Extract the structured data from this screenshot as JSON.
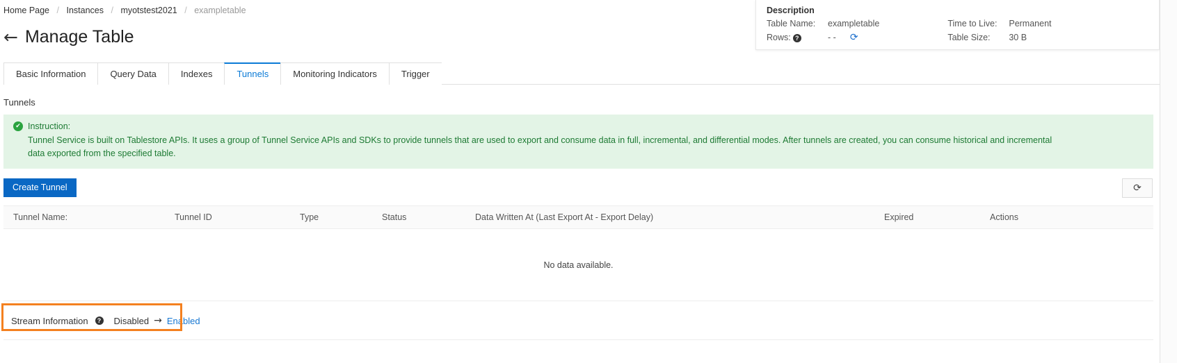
{
  "breadcrumb": {
    "items": [
      "Home Page",
      "Instances",
      "myotstest2021",
      "exampletable"
    ],
    "separator": "/"
  },
  "header": {
    "back_icon": "←",
    "title": "Manage Table"
  },
  "description_card": {
    "title": "Description",
    "rows": [
      {
        "label": "Table Name:",
        "value": "exampletable"
      },
      {
        "label": "Rows:",
        "value": "- -",
        "help_icon": "?",
        "refresh_icon": "⟳"
      },
      {
        "label": "Time to Live:",
        "value": "Permanent"
      },
      {
        "label": "Table Size:",
        "value": "30 B"
      }
    ]
  },
  "tabs": {
    "items": [
      {
        "label": "Basic Information",
        "active": false
      },
      {
        "label": "Query Data",
        "active": false
      },
      {
        "label": "Indexes",
        "active": false
      },
      {
        "label": "Tunnels",
        "active": true
      },
      {
        "label": "Monitoring Indicators",
        "active": false
      },
      {
        "label": "Trigger",
        "active": false
      }
    ],
    "active_color": "#0a7ad6"
  },
  "main": {
    "section_label": "Tunnels",
    "instruction": {
      "icon": "✔",
      "heading": "Instruction:",
      "body": "Tunnel Service is built on Tablestore APIs. It uses a group of Tunnel Service APIs and SDKs to provide tunnels that are used to export and consume data in full, incremental, and differential modes. After tunnels are created, you can consume historical and incremental data exported from the specified table.",
      "background": "#e3f4e6",
      "text_color": "#1d7a33"
    },
    "toolbar": {
      "create_label": "Create Tunnel",
      "create_color": "#0a68c4",
      "refresh_icon": "⟳"
    },
    "table": {
      "columns": [
        "Tunnel Name:",
        "Tunnel ID",
        "Type",
        "Status",
        "Data Written At (Last Export At - Export Delay)",
        "Expired",
        "Actions"
      ],
      "empty_text": "No data available.",
      "rows": []
    },
    "stream": {
      "label": "Stream Information",
      "help_icon": "?",
      "state": "Disabled",
      "arrow": "→",
      "action_label": "Enabled",
      "highlight_color": "#f4801f",
      "link_color": "#1677d2"
    }
  }
}
